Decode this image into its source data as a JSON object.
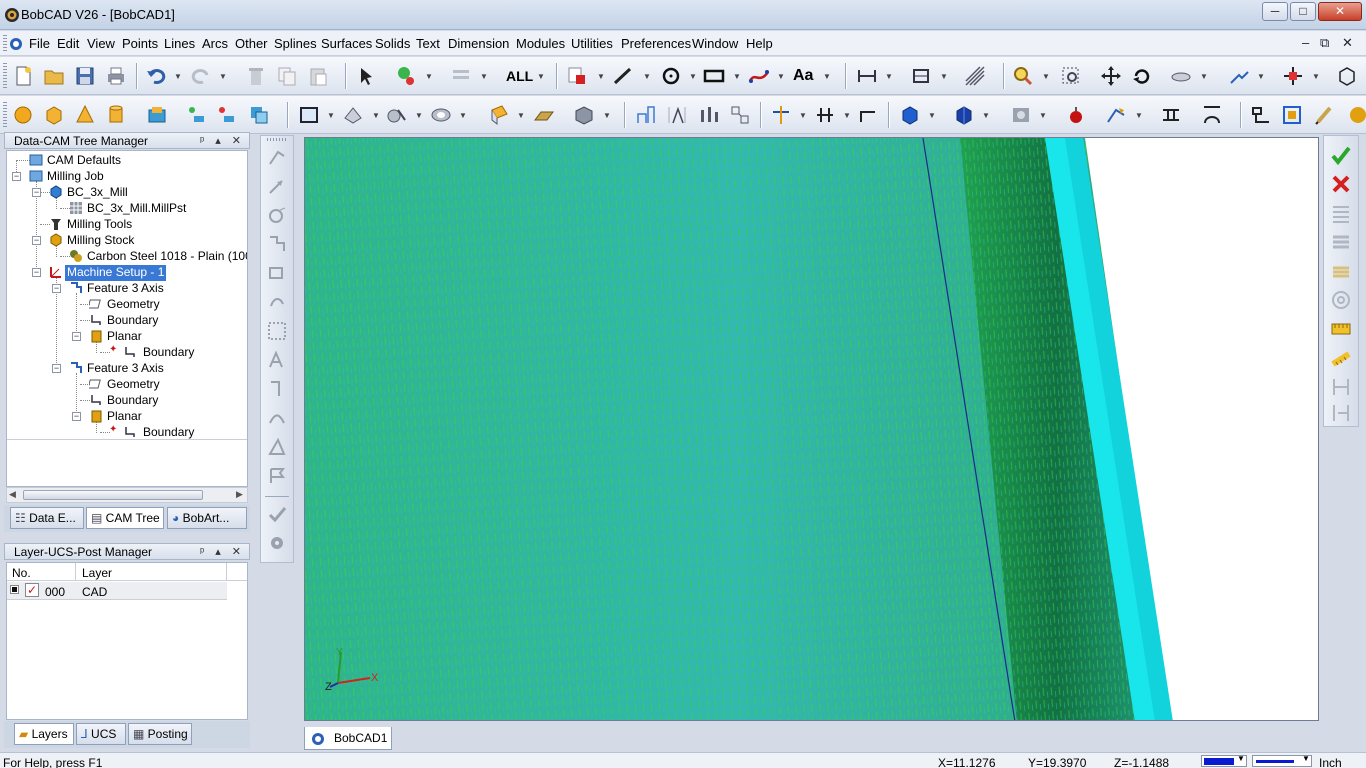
{
  "window": {
    "title": "BobCAD V26 - [BobCAD1]",
    "min": "─",
    "max": "□",
    "close": "✕"
  },
  "menu": {
    "items": [
      "File",
      "Edit",
      "View",
      "Points",
      "Lines",
      "Arcs",
      "Other",
      "Splines",
      "Surfaces",
      "Solids",
      "Text",
      "Dimension",
      "Modules",
      "Utilities",
      "Preferences",
      "Window",
      "Help"
    ],
    "mdi_min": "–",
    "mdi_restore": "⧉",
    "mdi_close": "✕"
  },
  "toolbar": {
    "all_label": "ALL"
  },
  "tree_manager": {
    "title": "Data-CAM Tree Manager",
    "pane_buttons": "ᵖ ▴ ✕",
    "nodes": [
      {
        "label": "CAM Defaults"
      },
      {
        "label": "Milling Job"
      },
      {
        "label": "BC_3x_Mill"
      },
      {
        "label": "BC_3x_Mill.MillPst"
      },
      {
        "label": "Milling Tools"
      },
      {
        "label": "Milling Stock"
      },
      {
        "label": "Carbon Steel 1018 - Plain (100-12"
      },
      {
        "label": "Machine Setup - 1"
      },
      {
        "label": "Feature 3 Axis"
      },
      {
        "label": "Geometry"
      },
      {
        "label": "Boundary"
      },
      {
        "label": "Planar"
      },
      {
        "label": "Boundary"
      },
      {
        "label": "Feature 3 Axis"
      },
      {
        "label": "Geometry"
      },
      {
        "label": "Boundary"
      },
      {
        "label": "Planar"
      },
      {
        "label": "Boundary"
      }
    ],
    "tabs": [
      "Data E...",
      "CAM Tree",
      "BobArt..."
    ]
  },
  "layer_manager": {
    "title": "Layer-UCS-Post Manager",
    "pane_buttons": "ᵖ ▴ ✕",
    "columns": [
      "No.",
      "Layer"
    ],
    "rows": [
      {
        "no": "000",
        "layer": "CAD"
      }
    ],
    "tabs": [
      "Layers",
      "UCS",
      "Posting"
    ]
  },
  "viewport": {
    "tab": "BobCAD1",
    "axes": {
      "x": "X",
      "y": "Y",
      "z": "Z"
    }
  },
  "status": {
    "help": "For Help, press F1",
    "x": "X=11.1276",
    "y": "Y=19.3970",
    "z": "Z=-1.1488",
    "units": "Inch"
  },
  "colors": {
    "accent": "#3a78d6",
    "toolpath": "#22c255",
    "stock": "#2fb9b0",
    "edge": "#14e0e6"
  }
}
